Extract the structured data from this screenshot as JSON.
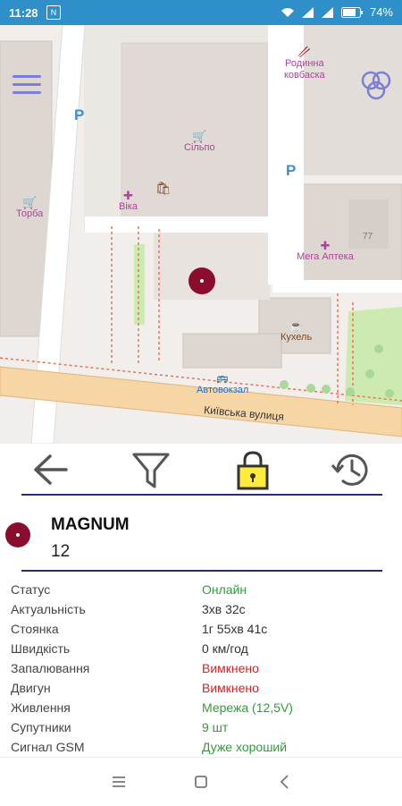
{
  "status_bar": {
    "time": "11:28",
    "notification": "N",
    "battery": "74%"
  },
  "map": {
    "pois": {
      "rodynna": "Родинна\nковбаска",
      "silpo": "Сільпо",
      "torba": "Торба",
      "vika": "Віка",
      "mega_apteka": "Мега Аптека",
      "kukhel": "Кухель",
      "avtovokzal": "Автовокзал",
      "street": "Київська вулиця",
      "house_number": "77",
      "parking": "P"
    }
  },
  "toolbar": {
    "back_icon": "arrow-left-icon",
    "filter_icon": "filter-icon",
    "lock_icon": "lock-icon",
    "history_icon": "history-icon",
    "lock_color": "#ffeb3b"
  },
  "device": {
    "name": "MAGNUM",
    "number": "12",
    "marker_color": "#8b0d2d"
  },
  "info_rows": [
    {
      "label": "Статус",
      "value": "Онлайн",
      "color": "green"
    },
    {
      "label": "Актуальність",
      "value": "3хв 32с",
      "color": ""
    },
    {
      "label": "Стоянка",
      "value": "1г 55хв 41с",
      "color": ""
    },
    {
      "label": "Швидкість",
      "value": "0 км/год",
      "color": ""
    },
    {
      "label": "Запалювання",
      "value": "Вимкнено",
      "color": "red"
    },
    {
      "label": "Двигун",
      "value": "Вимкнено",
      "color": "red"
    },
    {
      "label": "Живлення",
      "value": "Мережа (12,5V)",
      "color": "green"
    },
    {
      "label": "Супутники",
      "value": "9 шт",
      "color": "green"
    },
    {
      "label": "Сигнал GSM",
      "value": "Дуже хороший",
      "color": "green"
    }
  ],
  "colors": {
    "statusbar": "#2f8fc9",
    "green": "#2e9e39",
    "red": "#d72222",
    "divider": "#2b2d6b"
  }
}
